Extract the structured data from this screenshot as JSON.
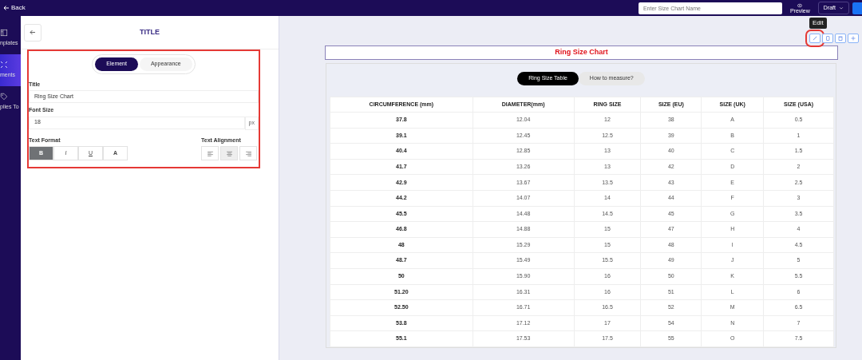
{
  "top_bar": {
    "back": "Back",
    "name_field": {
      "placeholder": "Enter Size Chart Name"
    },
    "preview": "Preview",
    "status": "Draft"
  },
  "sidebar": {
    "items": [
      {
        "label": "nplates",
        "kind": "templates",
        "selected": false
      },
      {
        "label": "ments",
        "kind": "elements",
        "selected": true
      },
      {
        "label": "plies To",
        "kind": "tag",
        "selected": false
      }
    ]
  },
  "panel": {
    "title": "TITLE",
    "tabs": [
      {
        "label": "Element",
        "selected": true
      },
      {
        "label": "Appearance",
        "selected": false
      }
    ],
    "title_field": {
      "label": "Title",
      "value": "Ring Size Chart"
    },
    "font_size_field": {
      "label": "Font Size",
      "value": "18",
      "unit": "px"
    },
    "text_format": {
      "label": "Text Format",
      "buttons": [
        {
          "label": "B",
          "selected": true
        },
        {
          "label": "I",
          "selected": false
        },
        {
          "label": "U",
          "selected": false
        },
        {
          "label": "A",
          "selected": false
        }
      ]
    },
    "text_alignment": {
      "label": "Text Alignment",
      "buttons": [
        {
          "kind": "left",
          "selected": false
        },
        {
          "kind": "center",
          "selected": true
        },
        {
          "kind": "right",
          "selected": false
        }
      ]
    }
  },
  "canvas": {
    "tooltip": "Edit",
    "actions": [
      {
        "kind": "edit",
        "highlighted": true
      },
      {
        "kind": "copy",
        "highlighted": false
      },
      {
        "kind": "delete",
        "highlighted": false
      },
      {
        "kind": "add",
        "highlighted": false
      }
    ],
    "chart_title": "Ring Size Chart",
    "tabs": [
      {
        "label": "Ring Size Table",
        "selected": true
      },
      {
        "label": "How to measure?",
        "selected": false
      }
    ],
    "table": {
      "columns": [
        "CIRCUMFERENCE (mm)",
        "DIAMETER(mm)",
        "RING SIZE",
        "SIZE (EU)",
        "SIZE (UK)",
        "SIZE (USA)"
      ],
      "rows": [
        [
          "37.8",
          "12.04",
          "12",
          "38",
          "A",
          "0.5"
        ],
        [
          "39.1",
          "12.45",
          "12.5",
          "39",
          "B",
          "1"
        ],
        [
          "40.4",
          "12.85",
          "13",
          "40",
          "C",
          "1.5"
        ],
        [
          "41.7",
          "13.26",
          "13",
          "42",
          "D",
          "2"
        ],
        [
          "42.9",
          "13.67",
          "13.5",
          "43",
          "E",
          "2.5"
        ],
        [
          "44.2",
          "14.07",
          "14",
          "44",
          "F",
          "3"
        ],
        [
          "45.5",
          "14.48",
          "14.5",
          "45",
          "G",
          "3.5"
        ],
        [
          "46.8",
          "14.88",
          "15",
          "47",
          "H",
          "4"
        ],
        [
          "48",
          "15.29",
          "15",
          "48",
          "I",
          "4.5"
        ],
        [
          "48.7",
          "15.49",
          "15.5",
          "49",
          "J",
          "5"
        ],
        [
          "50",
          "15.90",
          "16",
          "50",
          "K",
          "5.5"
        ],
        [
          "51.20",
          "16.31",
          "16",
          "51",
          "L",
          "6"
        ],
        [
          "52.50",
          "16.71",
          "16.5",
          "52",
          "M",
          "6.5"
        ],
        [
          "53.8",
          "17.12",
          "17",
          "54",
          "N",
          "7"
        ],
        [
          "55.1",
          "17.53",
          "17.5",
          "55",
          "O",
          "7.5"
        ]
      ]
    }
  }
}
